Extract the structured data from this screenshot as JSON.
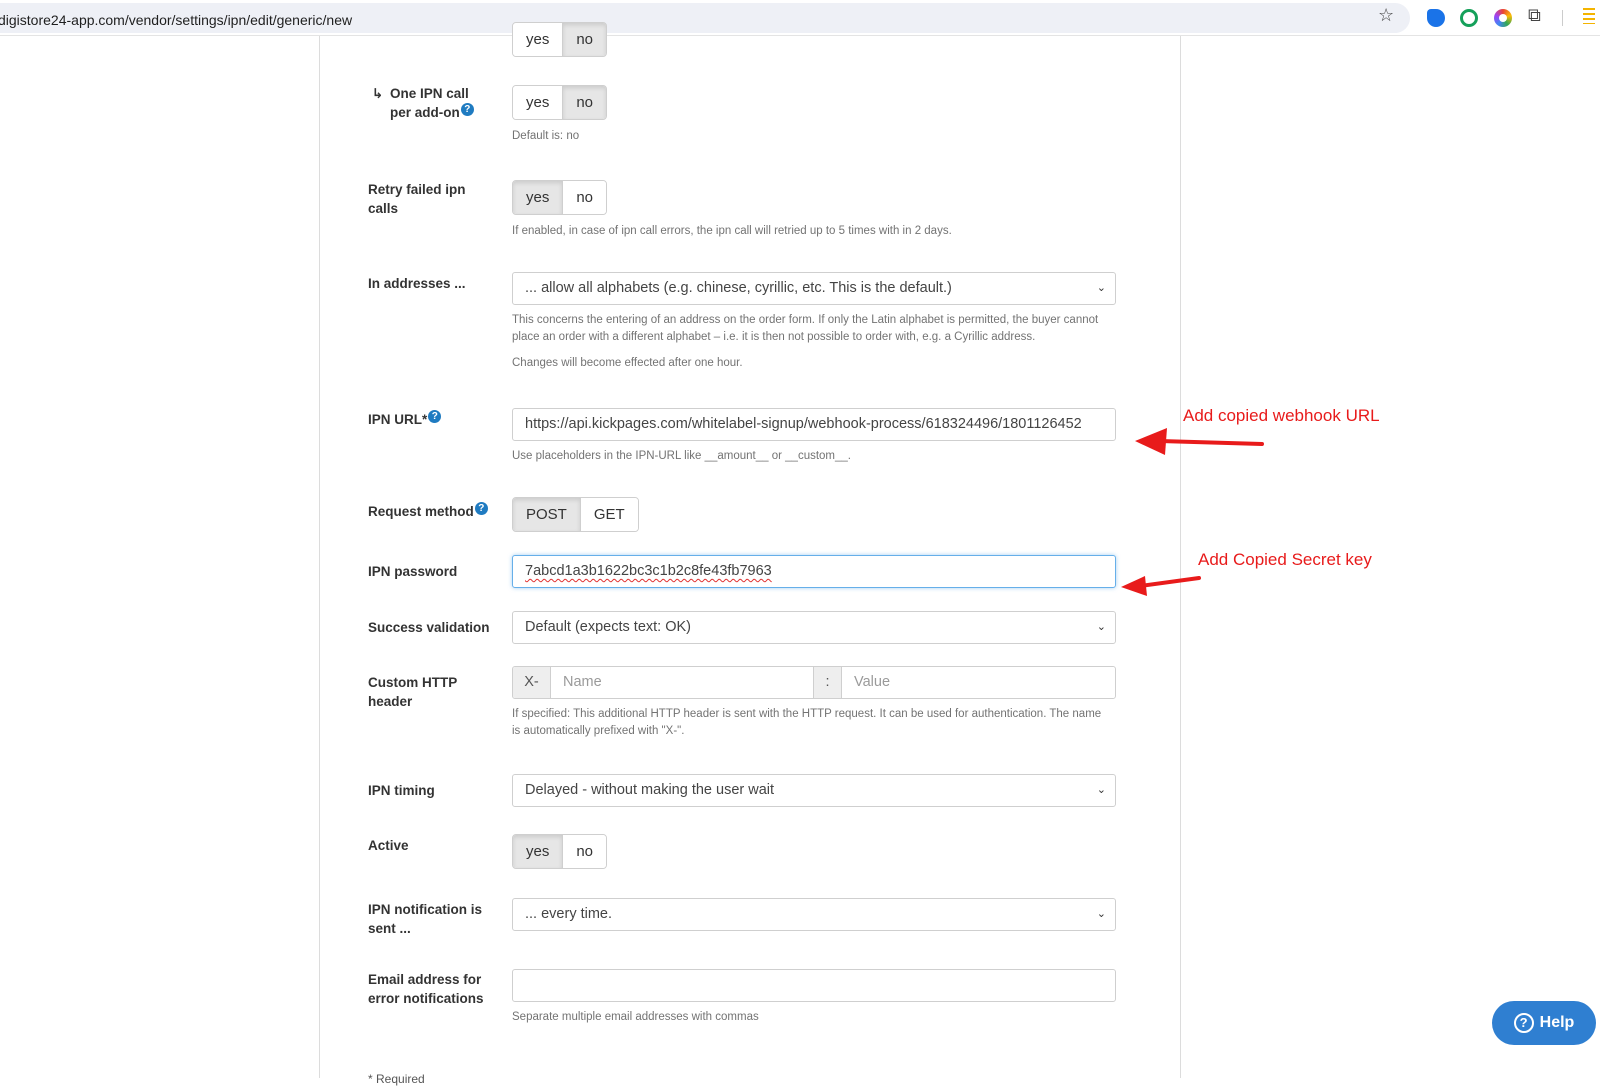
{
  "browser": {
    "url": "digistore24-app.com/vendor/settings/ipn/edit/generic/new"
  },
  "top_cut": {
    "yes": "yes",
    "no": "no"
  },
  "one_ipn_call": {
    "label": "One IPN call per add-on",
    "arrow": "↳",
    "yes": "yes",
    "no": "no",
    "selected": "no",
    "hint": "Default is: no"
  },
  "retry_failed": {
    "label": "Retry failed ipn calls",
    "yes": "yes",
    "no": "no",
    "selected": "yes",
    "hint": "If enabled, in case of ipn call errors, the ipn call will retried up to 5 times with in 2 days."
  },
  "in_addresses": {
    "label": "In addresses ...",
    "value": "... allow all alphabets (e.g. chinese, cyrillic, etc. This is the default.)",
    "hint1": "This concerns the entering of an address on the order form. If only the Latin alphabet is permitted, the buyer cannot place an order with a different alphabet – i.e. it is then not possible to order with, e.g. a Cyrillic address.",
    "hint2": "Changes will become effected after one hour."
  },
  "ipn_url": {
    "label": "IPN URL*",
    "value": "https://api.kickpages.com/whitelabel-signup/webhook-process/618324496/1801126452",
    "hint": "Use placeholders in the IPN-URL like __amount__ or __custom__."
  },
  "request_method": {
    "label": "Request method",
    "post": "POST",
    "get": "GET",
    "selected": "POST"
  },
  "ipn_password": {
    "label": "IPN password",
    "value": "7abcd1a3b1622bc3c1b2c8fe43fb7963"
  },
  "success_validation": {
    "label": "Success validation",
    "value": "Default (expects text: OK)"
  },
  "custom_header": {
    "label": "Custom HTTP header",
    "prefix": "X-",
    "name_placeholder": "Name",
    "separator": ":",
    "value_placeholder": "Value",
    "hint": "If specified: This additional HTTP header is sent with the HTTP request. It can be used for authentication. The name is automatically prefixed with \"X-\"."
  },
  "ipn_timing": {
    "label": "IPN timing",
    "value": "Delayed - without making the user wait"
  },
  "active": {
    "label": "Active",
    "yes": "yes",
    "no": "no",
    "selected": "yes"
  },
  "notification_sent": {
    "label": "IPN notification is sent ...",
    "value": "... every time."
  },
  "error_email": {
    "label": "Email address for error notifications",
    "value": "",
    "hint": "Separate multiple email addresses with commas"
  },
  "required_note": "* Required",
  "annotations": {
    "webhook": "Add copied webhook URL",
    "secret": "Add Copied Secret key",
    "arrow_color": "#e81b1b"
  },
  "help_button": {
    "label": "Help"
  },
  "icons": [
    "site-settings-icon",
    "star-icon",
    "extension-icons",
    "puzzle-icon",
    "help-icon",
    "chevron-down-icon"
  ]
}
